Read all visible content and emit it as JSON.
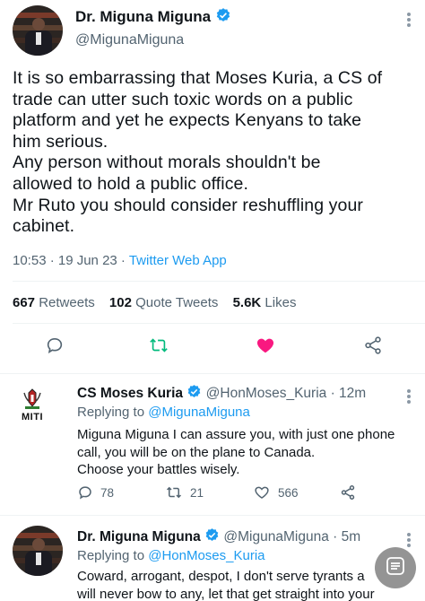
{
  "main_tweet": {
    "name": "Dr. Miguna Miguna",
    "handle": "@MigunaMiguna",
    "text_lines": [
      "It is so embarrassing that Moses Kuria, a CS of",
      "trade can utter such toxic words on a public",
      "platform and yet he expects Kenyans to take",
      "him serious.",
      "Any person without morals shouldn't be",
      "allowed to hold a public office.",
      "Mr Ruto you should consider reshuffling your",
      "cabinet."
    ],
    "time": "10:53 · 19 Jun 23 · ",
    "source": "Twitter Web App",
    "stats": {
      "retweets_count": "667",
      "retweets_label": "Retweets",
      "quotes_count": "102",
      "quotes_label": "Quote Tweets",
      "likes_count": "5.6K",
      "likes_label": "Likes"
    },
    "liked": true
  },
  "reply_1": {
    "name": "CS Moses Kuria",
    "handle": "@HonMoses_Kuria",
    "time": "· 12m",
    "replying_prefix": "Replying to",
    "replying_to": "@MigunaMiguna",
    "text_lines": [
      "Miguna Miguna I can assure you, with just one phone",
      "call, you will be on the plane to Canada.",
      "Choose your battles wisely."
    ],
    "logo_text": "MITI",
    "replies": "78",
    "retweets": "21",
    "likes": "566"
  },
  "reply_2": {
    "name": "Dr. Miguna Miguna",
    "handle": "@MigunaMiguna",
    "time": "· 5m",
    "replying_prefix": "Replying to",
    "replying_to": "@HonMoses_Kuria",
    "text_lines": [
      "Coward, arrogant, despot, I don't serve tyrants a",
      "will never bow to any, let that get straight into your"
    ]
  },
  "colors": {
    "accent": "#1d9bf0",
    "like": "#f91880",
    "retweet": "#00ba7c",
    "text": "#0f1419",
    "secondary": "#536471"
  },
  "icons": [
    "verified-icon",
    "reply-icon",
    "retweet-icon",
    "heart-icon",
    "share-icon",
    "more-icon",
    "reader-icon"
  ]
}
